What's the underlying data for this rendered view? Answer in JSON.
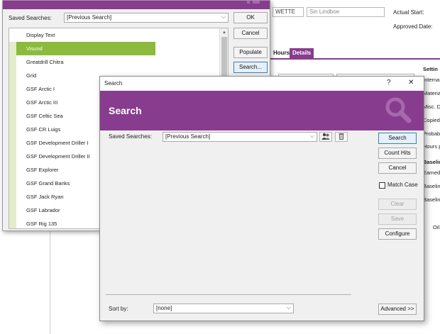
{
  "background": {
    "fields": {
      "initials": "WETTE",
      "name": "Sin Lindboe"
    },
    "labels": {
      "actual_start": "Actual Start:",
      "approved_date": "Approved Date:"
    },
    "tabs": {
      "hours": "Hours",
      "details": "Details"
    },
    "right_panel": {
      "settings": "Settin",
      "items": [
        "Interna",
        "Materia",
        "Misc. D",
        "Copied",
        "Probab",
        "Hours p"
      ],
      "baseline": "Baselin",
      "baseline_items": [
        "Earned",
        "Baselin",
        "Baselin"
      ],
      "oil": "Oil"
    },
    "accent_color": "#883c8e",
    "details_tab_color": "#883c8e"
  },
  "lookup_dialog": {
    "saved_searches_label": "Saved Searches:",
    "saved_searches_value": "[Previous Search]",
    "buttons": {
      "ok": "OK",
      "cancel": "Cancel",
      "populate": "Populate",
      "search": "Search..."
    },
    "list": {
      "header": "Display Text",
      "items": [
        "Visund",
        "Greatdrill Chitra",
        "Grid",
        "GSF Arctic I",
        "GSF Arctic III",
        "GSF Celtic Sea",
        "GSF CR Luigs",
        "GSF Development Driller I",
        "GSF Development Driller II",
        "GSF Explorer",
        "GSF Grand Banks",
        "GSF Jack Ryan",
        "GSF Labrador",
        "GSF Rig 135"
      ],
      "selected_index": 0,
      "selected_color": "#8cba3c"
    }
  },
  "search_dialog": {
    "window_title": "Search",
    "help_glyph": "?",
    "close_glyph": "✕",
    "banner_title": "Search",
    "banner_icon": "magnifier-icon",
    "saved_searches_label": "Saved Searches:",
    "saved_searches_value": "[Previous Search]",
    "buttons": {
      "search": "Search",
      "count_hits": "Count Hits",
      "cancel": "Cancel",
      "clear": "Clear",
      "save": "Save",
      "configure": "Configure",
      "advanced": "Advanced >>"
    },
    "match_case_label": "Match Case",
    "match_case_checked": false,
    "sort_by_label": "Sort by:",
    "sort_by_value": "[none]"
  }
}
